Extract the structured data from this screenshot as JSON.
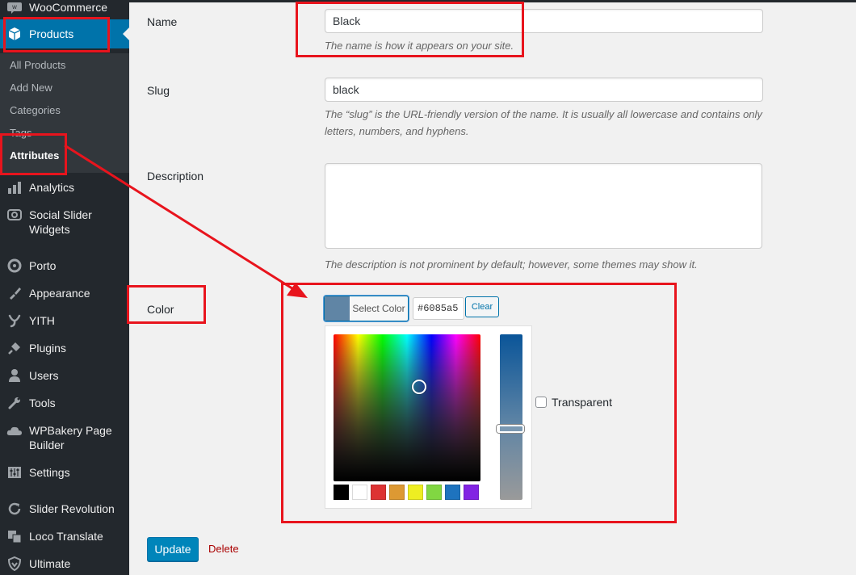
{
  "sidebar": {
    "woocommerce": "WooCommerce",
    "products": "Products",
    "submenu": [
      "All Products",
      "Add New",
      "Categories",
      "Tags",
      "Attributes"
    ],
    "items": [
      "Analytics",
      "Social Slider Widgets",
      "Porto",
      "Appearance",
      "YITH",
      "Plugins",
      "Users",
      "Tools",
      "WPBakery Page Builder",
      "Settings",
      "Slider Revolution",
      "Loco Translate",
      "Ultimate"
    ]
  },
  "form": {
    "name_label": "Name",
    "name_value": "Black",
    "name_desc": "The name is how it appears on your site.",
    "slug_label": "Slug",
    "slug_value": "black",
    "slug_desc": "The “slug” is the URL-friendly version of the name. It is usually all lowercase and contains only letters, numbers, and hyphens.",
    "description_label": "Description",
    "description_value": "",
    "description_desc": "The description is not prominent by default; however, some themes may show it.",
    "color_label": "Color",
    "select_color": "Select Color",
    "hex_value": "#6085a5",
    "clear": "Clear",
    "transparent": "Transparent",
    "update": "Update",
    "delete": "Delete"
  },
  "colors": {
    "selected": "#6085a5",
    "palette": [
      "#000000",
      "#ffffff",
      "#dd3333",
      "#dd9933",
      "#eeee22",
      "#81d742",
      "#1e73be",
      "#8224e3"
    ],
    "annotation": "#e8141d"
  }
}
